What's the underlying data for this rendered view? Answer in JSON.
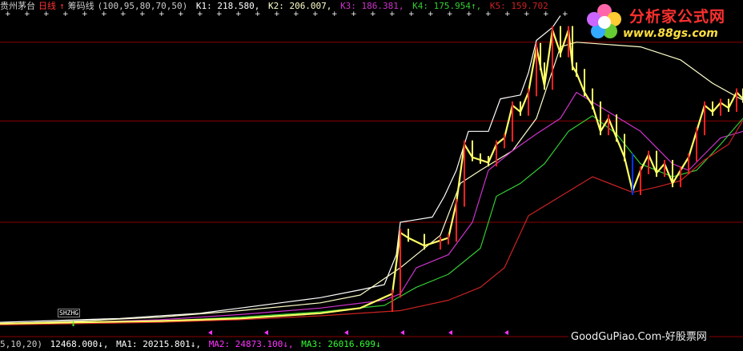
{
  "header": {
    "stock_name": "贵州茅台",
    "period": "日线",
    "indicator": "筹码线",
    "params": "(100,95,80,70,50)",
    "k1": "K1: 218.580,",
    "k2": "K2: 206.007,",
    "k3": "K3: 186.381,",
    "k4": "K4: 175.954↑,",
    "k5": "K5: 159.702"
  },
  "footer": {
    "params": "5,10,20)",
    "vol": "12468.000↓,",
    "ma1": "MA1: 20215.801↓,",
    "ma2": "MA2: 24873.100↓,",
    "ma3": "MA3: 26016.699↓"
  },
  "logo": {
    "title": "分析家公式网",
    "url": "www.88gs.com"
  },
  "watermark": "GoodGuPiao.Com-好股票网",
  "marker_label": "SHZHG",
  "colors": {
    "background": "#000000",
    "price": "#ffff66",
    "k1": "#ffffff",
    "k2": "#ffffcc",
    "k3": "#cc33cc",
    "k4": "#33cc33",
    "k5": "#cc2222",
    "grid": "#8b0000",
    "up_candle": "#ff2222",
    "down_candle": "#0033ff"
  },
  "chart_data": {
    "type": "line",
    "ylim": [
      0,
      240
    ],
    "reference_lines": [
      218.58,
      158.0,
      80.0
    ],
    "series": [
      {
        "name": "K1",
        "color": "#ffffff",
        "points": [
          [
            0,
            3
          ],
          [
            50,
            4
          ],
          [
            100,
            5
          ],
          [
            150,
            6
          ],
          [
            200,
            8
          ],
          [
            250,
            10
          ],
          [
            300,
            14
          ],
          [
            350,
            18
          ],
          [
            400,
            22
          ],
          [
            450,
            28
          ],
          [
            480,
            32
          ],
          [
            495,
            55
          ],
          [
            500,
            80
          ],
          [
            540,
            84
          ],
          [
            555,
            100
          ],
          [
            570,
            120
          ],
          [
            585,
            150
          ],
          [
            610,
            150
          ],
          [
            625,
            175
          ],
          [
            650,
            178
          ],
          [
            660,
            195
          ],
          [
            670,
            220
          ],
          [
            690,
            230
          ],
          [
            700,
            239
          ]
        ]
      },
      {
        "name": "K2",
        "color": "#ffffcc",
        "points": [
          [
            0,
            2
          ],
          [
            100,
            4
          ],
          [
            200,
            7
          ],
          [
            300,
            12
          ],
          [
            400,
            18
          ],
          [
            450,
            24
          ],
          [
            500,
            45
          ],
          [
            550,
            70
          ],
          [
            575,
            110
          ],
          [
            600,
            120
          ],
          [
            640,
            135
          ],
          [
            670,
            160
          ],
          [
            700,
            215
          ],
          [
            720,
            218.6
          ],
          [
            800,
            215
          ],
          [
            850,
            205
          ],
          [
            890,
            187
          ],
          [
            928,
            174
          ]
        ]
      },
      {
        "name": "K3",
        "color": "#cc33cc",
        "points": [
          [
            0,
            2
          ],
          [
            100,
            3
          ],
          [
            200,
            5
          ],
          [
            300,
            9
          ],
          [
            400,
            14
          ],
          [
            480,
            20
          ],
          [
            500,
            25
          ],
          [
            520,
            45
          ],
          [
            560,
            55
          ],
          [
            590,
            80
          ],
          [
            610,
            120
          ],
          [
            640,
            135
          ],
          [
            670,
            148
          ],
          [
            700,
            160
          ],
          [
            720,
            180
          ],
          [
            760,
            165
          ],
          [
            800,
            150
          ],
          [
            840,
            125
          ],
          [
            860,
            120
          ],
          [
            900,
            145
          ],
          [
            928,
            150
          ]
        ]
      },
      {
        "name": "K4",
        "color": "#33cc33",
        "points": [
          [
            0,
            1
          ],
          [
            100,
            3
          ],
          [
            200,
            4
          ],
          [
            300,
            7
          ],
          [
            400,
            11
          ],
          [
            480,
            16
          ],
          [
            520,
            30
          ],
          [
            560,
            40
          ],
          [
            600,
            60
          ],
          [
            620,
            100
          ],
          [
            650,
            110
          ],
          [
            680,
            125
          ],
          [
            710,
            150
          ],
          [
            740,
            162
          ],
          [
            770,
            148
          ],
          [
            800,
            125
          ],
          [
            840,
            115
          ],
          [
            870,
            120
          ],
          [
            900,
            140
          ],
          [
            928,
            160
          ]
        ]
      },
      {
        "name": "K5",
        "color": "#cc2222",
        "points": [
          [
            0,
            1
          ],
          [
            100,
            2
          ],
          [
            200,
            3
          ],
          [
            300,
            5
          ],
          [
            400,
            8
          ],
          [
            500,
            12
          ],
          [
            560,
            20
          ],
          [
            600,
            30
          ],
          [
            630,
            45
          ],
          [
            660,
            85
          ],
          [
            700,
            100
          ],
          [
            740,
            115
          ],
          [
            790,
            103
          ],
          [
            820,
            107
          ],
          [
            850,
            112
          ],
          [
            880,
            128
          ],
          [
            910,
            140
          ],
          [
            928,
            158.5
          ]
        ]
      },
      {
        "name": "Price",
        "color": "#ffff66",
        "points": [
          [
            0,
            2
          ],
          [
            100,
            3
          ],
          [
            200,
            4
          ],
          [
            300,
            6
          ],
          [
            400,
            10
          ],
          [
            450,
            14
          ],
          [
            490,
            25
          ],
          [
            500,
            72
          ],
          [
            510,
            68
          ],
          [
            530,
            62
          ],
          [
            550,
            66
          ],
          [
            560,
            68
          ],
          [
            570,
            95
          ],
          [
            580,
            140
          ],
          [
            590,
            130
          ],
          [
            600,
            128
          ],
          [
            610,
            126
          ],
          [
            620,
            140
          ],
          [
            630,
            145
          ],
          [
            640,
            170
          ],
          [
            650,
            165
          ],
          [
            660,
            180
          ],
          [
            670,
            215
          ],
          [
            675,
            200
          ],
          [
            680,
            185
          ],
          [
            690,
            228
          ],
          [
            700,
            210
          ],
          [
            710,
            228
          ],
          [
            715,
            200
          ],
          [
            720,
            195
          ],
          [
            730,
            180
          ],
          [
            740,
            170
          ],
          [
            750,
            150
          ],
          [
            760,
            160
          ],
          [
            770,
            145
          ],
          [
            780,
            130
          ],
          [
            790,
            104
          ],
          [
            800,
            120
          ],
          [
            810,
            132
          ],
          [
            820,
            118
          ],
          [
            830,
            125
          ],
          [
            840,
            110
          ],
          [
            850,
            120
          ],
          [
            860,
            130
          ],
          [
            870,
            150
          ],
          [
            880,
            170
          ],
          [
            890,
            165
          ],
          [
            900,
            172
          ],
          [
            910,
            168
          ],
          [
            920,
            180
          ],
          [
            928,
            175
          ]
        ]
      }
    ]
  }
}
